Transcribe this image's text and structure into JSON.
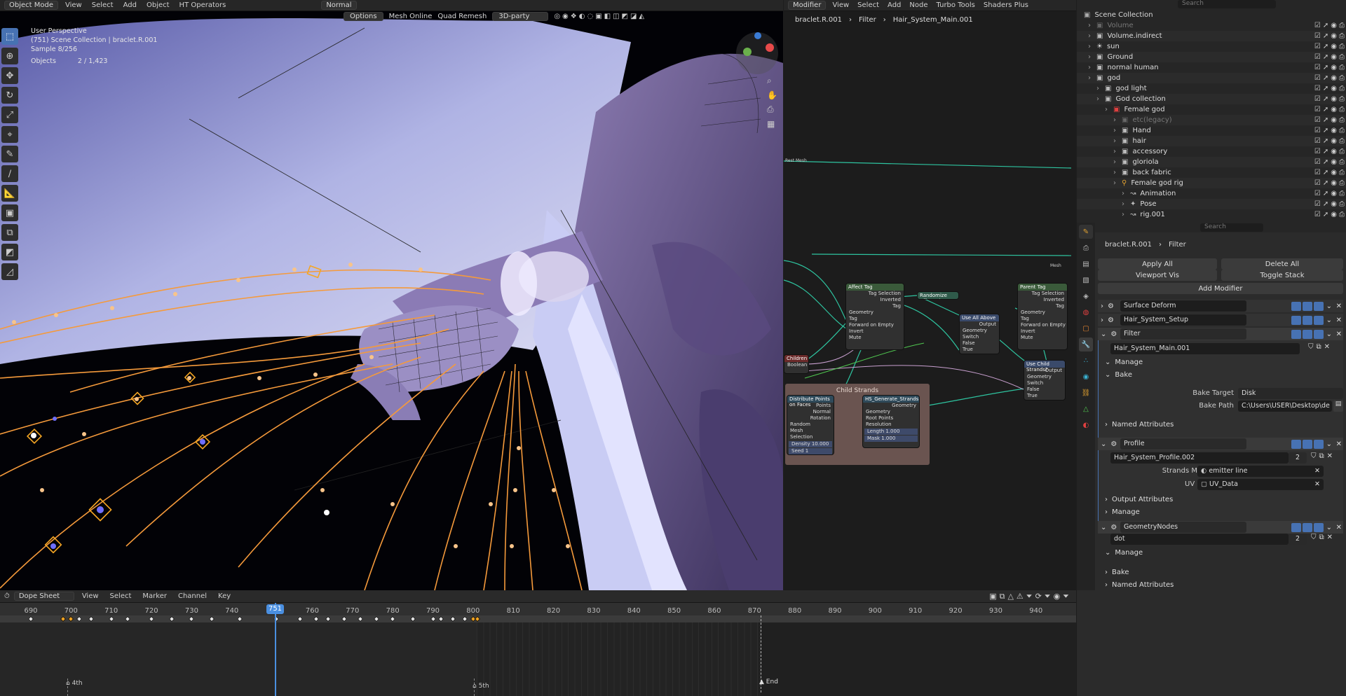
{
  "viewport": {
    "mode": "Object Mode",
    "menu": [
      "View",
      "Select",
      "Add",
      "Object",
      "HT Operators"
    ],
    "transform_orientation": "Normal",
    "options": "Options",
    "mesh_online": "Mesh Online",
    "quad_remesh": "Quad Remesh",
    "third_party": "3D-party",
    "overlay_lines": [
      "User Perspective",
      "(751) Scene Collection | braclet.R.001",
      "Sample 8/256"
    ],
    "objects_label": "Objects",
    "objects_value": "2 / 1,423",
    "tools": [
      "select-box",
      "cursor",
      "move",
      "rotate",
      "scale",
      "transform",
      "annotate",
      "draw",
      "measure",
      "add-cube",
      "extrude",
      "shade",
      "shear"
    ]
  },
  "node_editor": {
    "editor_type": "Modifier",
    "menu": [
      "View",
      "Select",
      "Add",
      "Node",
      "Turbo Tools",
      "Shaders Plus"
    ],
    "breadcrumb": [
      "braclet.R.001",
      "Filter",
      "Hair_System_Main.001"
    ],
    "frame_label": "Child Strands",
    "nodes": [
      {
        "title": "Affect Tag",
        "rows": [
          "Tag Selection",
          "Inverted",
          "Tag",
          "Geometry",
          "Tag",
          "Forward on Empty",
          "Invert",
          "Mute"
        ],
        "color": "#3a5a3a"
      },
      {
        "title": "Parent Tag",
        "rows": [
          "Tag Selection",
          "Inverted",
          "Tag",
          "Geometry",
          "Tag",
          "Forward on Empty",
          "Invert",
          "Mute"
        ],
        "color": "#3a5a3a"
      },
      {
        "title": "Use All Above",
        "rows": [
          "Output",
          "Geometry",
          "Switch",
          "False",
          "True"
        ],
        "color": "#3a4a6a"
      },
      {
        "title": "Use Child Strands?",
        "rows": [
          "Output",
          "Geometry",
          "Switch",
          "False",
          "True"
        ],
        "color": "#3a4a6a"
      },
      {
        "title": "Distribute Points on Faces",
        "rows": [
          "Points",
          "Normal",
          "Rotation",
          "Random",
          "Mesh",
          "Selection",
          "Density 10.000",
          "Seed 1"
        ],
        "color": "#2f4a5a"
      },
      {
        "title": "HS_Generate_Strands",
        "rows": [
          "Geometry",
          "Geometry",
          "Root Points",
          "Resolution",
          "Length 1.000",
          "Mask 1.000"
        ],
        "color": "#2f4a5a"
      },
      {
        "title": "Children",
        "rows": [
          "Boolean"
        ],
        "color": "#6a2a2a"
      },
      {
        "title": "Randomize Affected",
        "rows": [],
        "color": "#2f5a4a"
      }
    ],
    "labels": {
      "rest_mesh": "Rest Mesh",
      "mesh": "Mesh"
    }
  },
  "outliner": {
    "search_placeholder": "Search",
    "root": "Scene Collection",
    "rows": [
      {
        "label": "Volume",
        "indent": 1,
        "dim": true
      },
      {
        "label": "Volume.indirect",
        "indent": 1
      },
      {
        "label": "sun",
        "indent": 1
      },
      {
        "label": "Ground",
        "indent": 1
      },
      {
        "label": "normal human",
        "indent": 1
      },
      {
        "label": "god",
        "indent": 1
      },
      {
        "label": "god light",
        "indent": 2
      },
      {
        "label": "God collection",
        "indent": 2
      },
      {
        "label": "Female god",
        "indent": 3
      },
      {
        "label": "etc(legacy)",
        "indent": 4,
        "dim": true
      },
      {
        "label": "Hand",
        "indent": 4
      },
      {
        "label": "hair",
        "indent": 4
      },
      {
        "label": "accessory",
        "indent": 4
      },
      {
        "label": "gloriola",
        "indent": 4
      },
      {
        "label": "back fabric",
        "indent": 4
      },
      {
        "label": "Female god rig",
        "indent": 4
      },
      {
        "label": "Animation",
        "indent": 5
      },
      {
        "label": "Pose",
        "indent": 5
      },
      {
        "label": "rig.001",
        "indent": 5
      }
    ]
  },
  "properties": {
    "search_placeholder": "Search",
    "breadcrumb": [
      "braclet.R.001",
      "Filter"
    ],
    "apply_all": "Apply All",
    "delete_all": "Delete All",
    "viewport_vis": "Viewport Vis",
    "toggle_stack": "Toggle Stack",
    "add_modifier": "Add Modifier",
    "modifiers": [
      {
        "name": "Surface Deform",
        "expanded": false
      },
      {
        "name": "Hair_System_Setup",
        "expanded": false
      },
      {
        "name": "Filter",
        "expanded": true
      }
    ],
    "filter": {
      "node_group": "Hair_System_Main.001",
      "manage": "Manage",
      "bake": "Bake",
      "bake_target_label": "Bake Target",
      "bake_target_value": "Disk",
      "bake_path_label": "Bake Path",
      "bake_path_value": "C:\\Users\\USER\\Desktop\\de pan re\\god\\acc...",
      "named_attributes": "Named Attributes"
    },
    "profile": {
      "name": "Profile",
      "node_group": "Hair_System_Profile.002",
      "users": "2",
      "strands_material_label": "Strands Material",
      "strands_material_value": "emitter line",
      "uv_owner_label": "UV Owner",
      "uv_owner_value": "UV_Data",
      "output_attributes": "Output Attributes",
      "manage": "Manage"
    },
    "geometry_nodes": {
      "name": "GeometryNodes",
      "node_group": "dot",
      "users": "2",
      "manage": "Manage",
      "bake": "Bake",
      "named_attributes": "Named Attributes"
    }
  },
  "dope_sheet": {
    "editor_type": "Dope Sheet",
    "menu": [
      "View",
      "Select",
      "Marker",
      "Channel",
      "Key"
    ],
    "current_frame": "751",
    "ticks": [
      "690",
      "700",
      "710",
      "720",
      "730",
      "740",
      "760",
      "770",
      "780",
      "790",
      "800",
      "810",
      "820",
      "830",
      "840",
      "850",
      "860",
      "870",
      "880",
      "890",
      "900",
      "910",
      "920",
      "930",
      "940"
    ],
    "markers": [
      "4th",
      "5th",
      "End"
    ]
  }
}
